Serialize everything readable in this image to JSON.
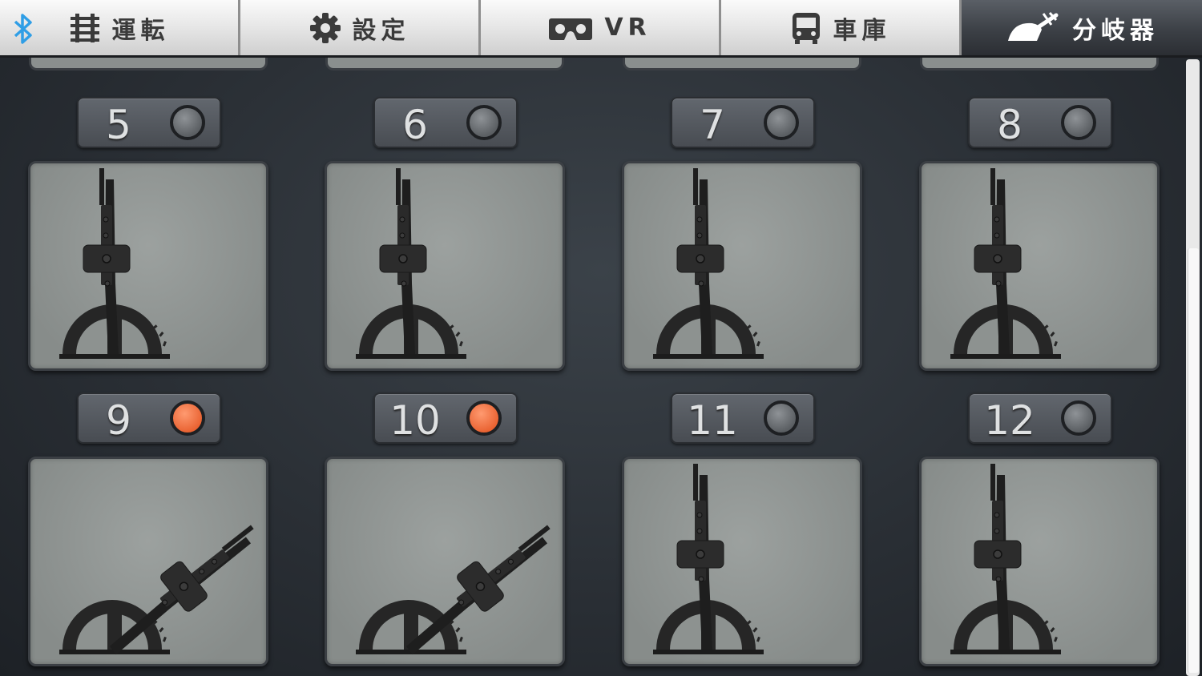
{
  "tabs": [
    {
      "label": "運転",
      "icon": "track-icon"
    },
    {
      "label": "設定",
      "icon": "gear-icon"
    },
    {
      "label": "VR",
      "icon": "vr-goggles-icon"
    },
    {
      "label": "車庫",
      "icon": "train-icon"
    },
    {
      "label": "分岐器",
      "icon": "turnout-lever-icon",
      "active": true
    }
  ],
  "bluetooth_icon": "bluetooth-icon",
  "switches": [
    {
      "number": "5",
      "lamp": "off",
      "lever": "straight"
    },
    {
      "number": "6",
      "lamp": "off",
      "lever": "straight"
    },
    {
      "number": "7",
      "lamp": "off",
      "lever": "straight"
    },
    {
      "number": "8",
      "lamp": "off",
      "lever": "straight"
    },
    {
      "number": "9",
      "lamp": "on",
      "lever": "diverged"
    },
    {
      "number": "10",
      "lamp": "on",
      "lever": "diverged"
    },
    {
      "number": "11",
      "lamp": "off",
      "lever": "straight"
    },
    {
      "number": "12",
      "lamp": "off",
      "lever": "straight"
    }
  ],
  "colors": {
    "lamp_on": "#e8602f",
    "lamp_off": "#6a6e72",
    "bluetooth": "#2f9ee6",
    "active_tab": "#3c4046"
  }
}
